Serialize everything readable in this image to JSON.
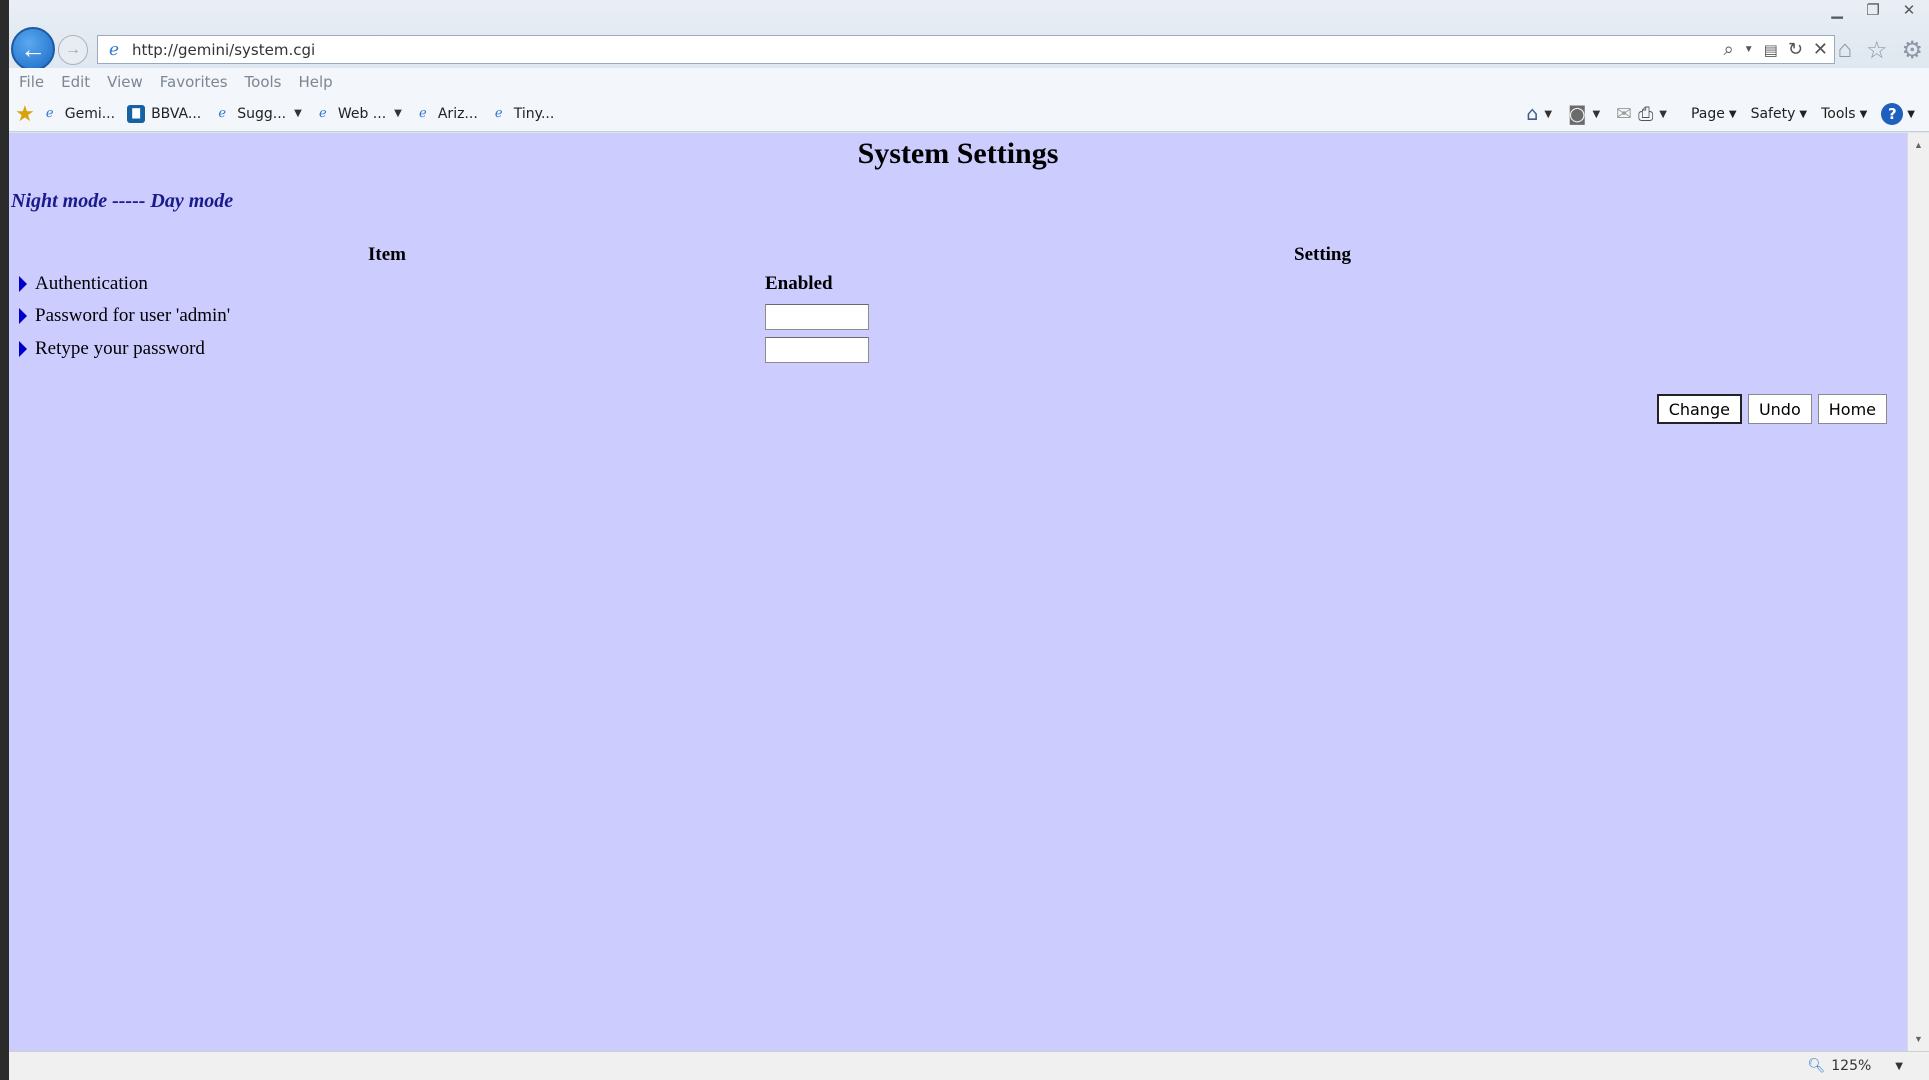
{
  "browser": {
    "url": "http://gemini/system.cgi",
    "menus": [
      "File",
      "Edit",
      "View",
      "Favorites",
      "Tools",
      "Help"
    ],
    "favorites": [
      {
        "label": "Gemi...",
        "caret": false
      },
      {
        "label": "BBVA...",
        "caret": false
      },
      {
        "label": "Sugg...",
        "caret": true
      },
      {
        "label": "Web ...",
        "caret": true
      },
      {
        "label": "Ariz...",
        "caret": false
      },
      {
        "label": "Tiny...",
        "caret": false
      }
    ],
    "commands": {
      "page": "Page",
      "safety": "Safety",
      "tools": "Tools",
      "help": "?"
    },
    "zoom": "125%"
  },
  "page": {
    "title": "System Settings",
    "mode_toggle": "Night mode ----- Day mode",
    "columns": {
      "item": "Item",
      "setting": "Setting"
    },
    "rows": [
      {
        "label": "Authentication",
        "value": "Enabled"
      },
      {
        "label": "Password for user 'admin'",
        "value": ""
      },
      {
        "label": "Retype your password",
        "value": ""
      }
    ],
    "buttons": {
      "change": "Change",
      "undo": "Undo",
      "home": "Home"
    }
  },
  "colors": {
    "page_bg": "#ccccff",
    "link": "#1a1a8c",
    "triangle": "#0000cc"
  }
}
